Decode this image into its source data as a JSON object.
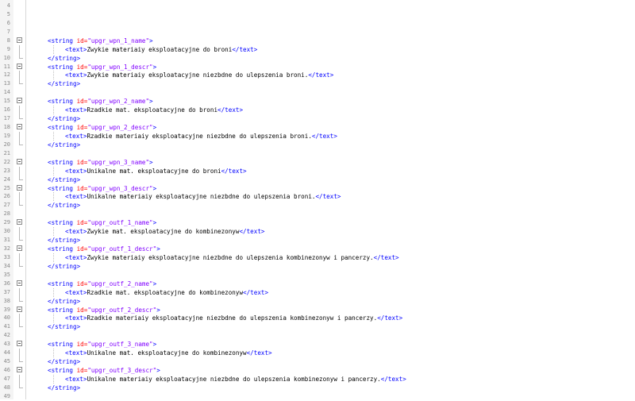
{
  "editor": {
    "line_numbers": [
      "4",
      "5",
      "6",
      "7",
      "8",
      "9",
      "10",
      "11",
      "12",
      "13",
      "14",
      "15",
      "16",
      "17",
      "18",
      "19",
      "20",
      "21",
      "22",
      "23",
      "24",
      "25",
      "26",
      "27",
      "28",
      "29",
      "30",
      "31",
      "32",
      "33",
      "34",
      "35",
      "36",
      "37",
      "38",
      "39",
      "40",
      "41",
      "42",
      "43",
      "44",
      "45",
      "46",
      "47",
      "48",
      "49"
    ],
    "syntax_colors": {
      "tag": "#0000ff",
      "attribute": "#ff0000",
      "value": "#8000ff",
      "text": "#000000"
    },
    "tokens": {
      "string_open": "<string",
      "id_attr": " id=",
      "string_tag_end": ">",
      "text_open": "<text>",
      "text_close": "</text>",
      "string_close": "</string>"
    },
    "entries": [
      {
        "id": "\"upgr_wpn_1_name\"",
        "text": "Zwykie materiaiy eksploatacyjne do broni"
      },
      {
        "id": "\"upgr_wpn_1_descr\"",
        "text": "Zwykie materiaiy eksploatacyjne niezbdne do ulepszenia broni."
      },
      {
        "id": "\"upgr_wpn_2_name\"",
        "text": "Rzadkie mat. eksploatacyjne do broni"
      },
      {
        "id": "\"upgr_wpn_2_descr\"",
        "text": "Rzadkie materiaiy eksploatacyjne niezbdne do ulepszenia broni."
      },
      {
        "id": "\"upgr_wpn_3_name\"",
        "text": "Unikalne mat. eksploatacyjne do broni"
      },
      {
        "id": "\"upgr_wpn_3_descr\"",
        "text": "Unikalne materiaiy eksploatacyjne niezbdne do ulepszenia broni."
      },
      {
        "id": "\"upgr_outf_1_name\"",
        "text": "Zwykie mat. eksploatacyjne do kombinezonyw"
      },
      {
        "id": "\"upgr_outf_1_descr\"",
        "text": "Zwykie materiaiy eksploatacyjne niezbdne do ulepszenia kombinezonyw i pancerzy."
      },
      {
        "id": "\"upgr_outf_2_name\"",
        "text": "Rzadkie mat. eksploatacyjne do kombinezonyw"
      },
      {
        "id": "\"upgr_outf_2_descr\"",
        "text": "Rzadkie materiaiy eksploatacyjne niezbdne do ulepszenia kombinezonyw i pancerzy."
      },
      {
        "id": "\"upgr_outf_3_name\"",
        "text": "Unikalne mat. eksploatacyjne do kombinezonyw"
      },
      {
        "id": "\"upgr_outf_3_descr\"",
        "text": "Unikalne materiaiy eksploatacyjne niezbdne do ulepszenia kombinezonyw i pancerzy."
      }
    ]
  }
}
